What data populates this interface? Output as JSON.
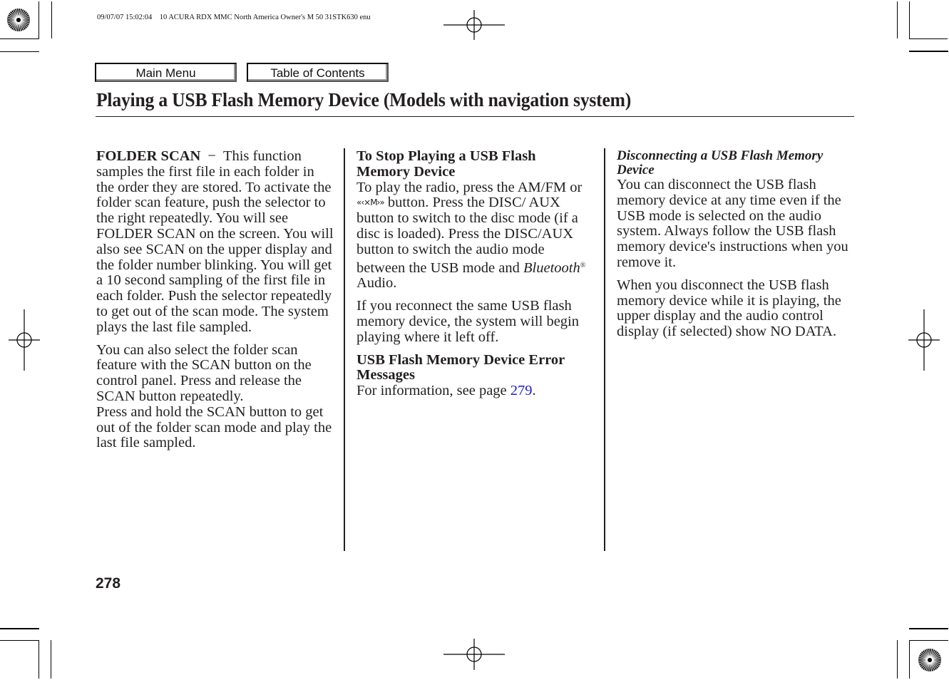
{
  "print_header": {
    "text": "09/07/07 15:02:04    10 ACURA RDX MMC North America Owner's M 50 31STK630 enu"
  },
  "nav": {
    "main_menu_label": "Main Menu",
    "toc_label": "Table of Contents"
  },
  "page": {
    "title": "Playing a USB Flash Memory Device (Models with navigation system)",
    "number": "278"
  },
  "column1": {
    "folder_scan_heading": "FOLDER SCAN",
    "dash": "−",
    "folder_scan_text": "This function samples the first file in each folder in the order they are stored. To activate the folder scan feature, push the selector to the right repeatedly. You will see FOLDER SCAN on the screen. You will also see SCAN on the upper display and the folder number blinking. You will get a 10 second sampling of the first file in each folder. Push the selector repeatedly to get out of the scan mode. The system plays the last file sampled.",
    "para2": "You can also select the folder scan feature with the SCAN button on the control panel. Press and release the SCAN button repeatedly.",
    "para3": "Press and hold the SCAN button to get out of the folder scan mode and play the last file sampled."
  },
  "column2": {
    "stop_heading": "To Stop Playing a USB Flash Memory Device",
    "stop_text_1": "To play the radio, press the AM/FM or",
    "xm_symbol": "«‹×M›»",
    "stop_text_2": "button. Press the DISC/ AUX button to switch to the disc mode (if a disc is loaded). Press the DISC/AUX button to switch the audio mode between the USB mode and",
    "bluetooth": "Bluetooth",
    "registered": "®",
    "stop_text_3": "Audio.",
    "reconnect_text": "If you reconnect the same USB flash memory device, the system will begin playing where it left off.",
    "error_heading": "USB Flash Memory Device Error Messages",
    "error_text": "For information, see page",
    "error_link": "279",
    "error_period": "."
  },
  "column3": {
    "disconnect_heading": "Disconnecting a USB Flash Memory Device",
    "disconnect_text": "You can disconnect the USB flash memory device at any time even if the USB mode is selected on the audio system. Always follow the USB flash memory device's instructions when you remove it.",
    "playing_text": "When you disconnect the USB flash memory device while it is playing, the upper display and the audio control display (if selected) show NO DATA."
  }
}
